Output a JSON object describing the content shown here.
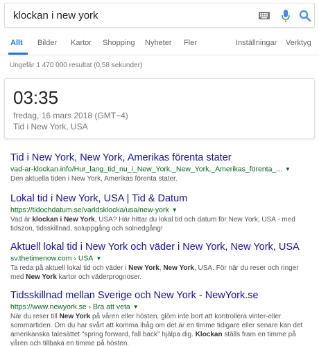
{
  "search": {
    "query": "klockan i new york"
  },
  "tabs": [
    {
      "label": "Allt"
    },
    {
      "label": "Bilder"
    },
    {
      "label": "Kartor"
    },
    {
      "label": "Shopping"
    },
    {
      "label": "Nyheter"
    },
    {
      "label": "Fler"
    },
    {
      "label": "Inställningar"
    },
    {
      "label": "Verktyg"
    }
  ],
  "stats": "Ungefär 1 470 000 resultat (0,58 sekunder)",
  "clock": {
    "time": "03:35",
    "date": "fredag, 16 mars 2018 (GMT−4)",
    "place": "Tid i New York, USA"
  },
  "results": [
    {
      "title": "Tid i New York, New York, Amerikas förenta stater",
      "url": "vad-ar-klockan.info/Hur_lang_tid_nu_i_New_York,_New_York,_Amerikas_förenta_...",
      "snippet": [
        {
          "t": "Den aktuella tiden i New York, Amerikas förenta stater.",
          "b": false
        }
      ]
    },
    {
      "title": "Lokal tid i New York, USA | Tid & Datum",
      "url": "https://tidochdatum.se/varldsklocka/usa/new-york",
      "snippet": [
        {
          "t": "Vad är ",
          "b": false
        },
        {
          "t": "klockan i New York",
          "b": true
        },
        {
          "t": ", USA? Här hittar du lokal tid och datum för New York, USA - med tidszon, tidsskillnad, soluppgång och solnedgång!",
          "b": false
        }
      ]
    },
    {
      "title": "Aktuell lokal tid i New York och väder i New York, New York, USA",
      "url": "sv.thetimenow.com › USA",
      "snippet": [
        {
          "t": "Ta reda på aktuell lokal tid och väder i ",
          "b": false
        },
        {
          "t": "New York",
          "b": true
        },
        {
          "t": ", ",
          "b": false
        },
        {
          "t": "New York",
          "b": true
        },
        {
          "t": ", USA. För när du reser och ringer med ",
          "b": false
        },
        {
          "t": "New York",
          "b": true
        },
        {
          "t": " kartor och väderprognoser.",
          "b": false
        }
      ]
    },
    {
      "title": "Tidsskillnad mellan Sverige och New York - NewYork.se",
      "url": "https://www.newyork.se › Bra att veta",
      "snippet": [
        {
          "t": "När du reser till ",
          "b": false
        },
        {
          "t": "New York",
          "b": true
        },
        {
          "t": " på våren eller hösten, glöm inte bort att kontrollera vinter-eller sommartiden. Om du har svårt att komma ihåg om det är en timme tidigare eller senare kan det amerikanska talesättet \"spring forward, fall back\" hjälpa dig. ",
          "b": false
        },
        {
          "t": "Klockan",
          "b": true
        },
        {
          "t": " ställs fram en timme på våren och tillbaka en timme på hösten.",
          "b": false
        }
      ]
    }
  ],
  "colors": {
    "link": "#1a0dab",
    "url": "#006621",
    "accent": "#1a73e8",
    "snippet": "#545454"
  },
  "icons": [
    "keyboard-icon",
    "microphone-icon",
    "search-icon",
    "url-dropdown-caret"
  ]
}
